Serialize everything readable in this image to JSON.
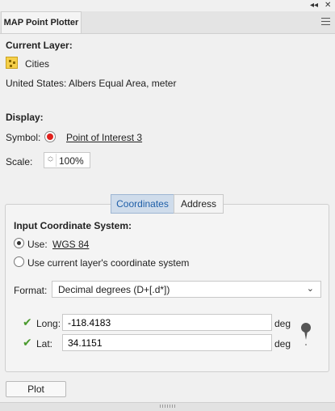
{
  "window": {
    "tab_title": "MAP Point Plotter"
  },
  "current_layer": {
    "heading": "Current Layer:",
    "layer_name": "Cities",
    "projection": "United States: Albers Equal Area, meter"
  },
  "display": {
    "heading": "Display:",
    "symbol_label": "Symbol:",
    "symbol_name": "Point of Interest 3",
    "scale_label": "Scale:",
    "scale_value": "100%"
  },
  "tabs": {
    "coordinates": "Coordinates",
    "address": "Address",
    "active": "coordinates"
  },
  "input_cs": {
    "heading": "Input Coordinate System:",
    "use_label": "Use:",
    "use_value": "WGS 84",
    "current_layer_option": "Use current layer's coordinate system",
    "selected": "use"
  },
  "format": {
    "label": "Format:",
    "value": "Decimal degrees (D+[.d*])"
  },
  "coords": {
    "long_label": "Long:",
    "long_value": "-118.4183",
    "lat_label": "Lat:",
    "lat_value": "34.1151",
    "unit": "deg"
  },
  "actions": {
    "plot_label": "Plot"
  },
  "colors": {
    "accent": "#1f5fa8",
    "symbol": "#e0211d",
    "check": "#4a9a2e"
  }
}
